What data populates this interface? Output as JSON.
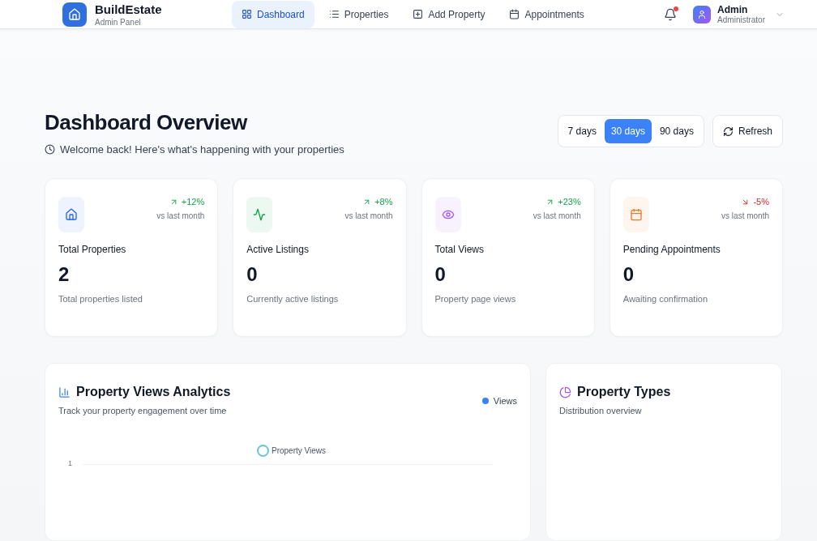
{
  "brand": {
    "name": "BuildEstate",
    "subtitle": "Admin Panel"
  },
  "nav": [
    {
      "label": "Dashboard",
      "kind": "grid",
      "selected": true
    },
    {
      "label": "Properties",
      "kind": "list",
      "selected": false
    },
    {
      "label": "Add Property",
      "kind": "plus",
      "selected": false
    },
    {
      "label": "Appointments",
      "kind": "calendar",
      "selected": false
    }
  ],
  "notifications": {
    "unread": true
  },
  "user": {
    "name": "Admin",
    "role": "Administrator"
  },
  "header": {
    "title": "Dashboard Overview",
    "subtitle": "Welcome back! Here's what's happening with your properties"
  },
  "ranges": [
    {
      "label": "7 days",
      "selected": false
    },
    {
      "label": "30 days",
      "selected": true
    },
    {
      "label": "90 days",
      "selected": false
    }
  ],
  "refresh": "Refresh",
  "stats": [
    {
      "kind": "home",
      "color": "#2563eb",
      "rising": true,
      "change": "+12%",
      "compare": "vs last month",
      "label": "Total Properties",
      "value": "2",
      "caption": "Total properties listed"
    },
    {
      "kind": "activity",
      "color": "#16a34a",
      "rising": true,
      "change": "+8%",
      "compare": "vs last month",
      "label": "Active Listings",
      "value": "0",
      "caption": "Currently active listings"
    },
    {
      "kind": "eye",
      "color": "#a855f7",
      "rising": true,
      "change": "+23%",
      "compare": "vs last month",
      "label": "Total Views",
      "value": "0",
      "caption": "Property page views"
    },
    {
      "kind": "calendar",
      "color": "#ea7a2c",
      "rising": false,
      "change": "-5%",
      "compare": "vs last month",
      "label": "Pending Appointments",
      "value": "0",
      "caption": "Awaiting confirmation"
    }
  ],
  "analytics": {
    "title": "Property Views Analytics",
    "subtitle": "Track your property engagement over time",
    "legend": "Views",
    "series_label": "Property Views",
    "y_tick": "1"
  },
  "types": {
    "title": "Property Types",
    "subtitle": "Distribution overview"
  }
}
